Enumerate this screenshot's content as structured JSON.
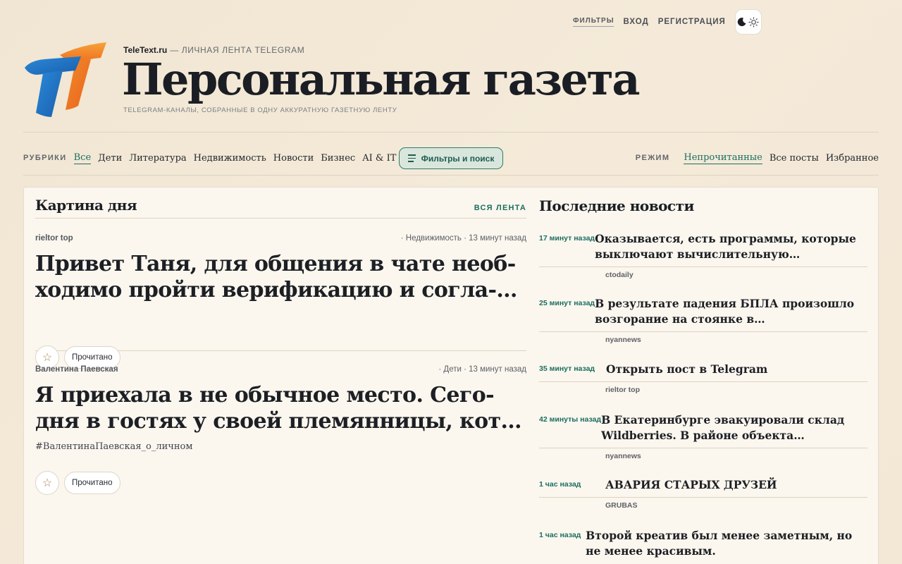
{
  "topnav": {
    "filters": "ФИЛЬТРЫ",
    "login": "ВХОД",
    "register": "РЕГИСТРАЦИЯ"
  },
  "masthead": {
    "site": "TeleText.ru",
    "tagline": "— ЛИЧНАЯ ЛЕНТА TELEGRAM",
    "title": "Персональная газета",
    "subtitle": "TELEGRAM-КАНАЛЫ, СОБРАННЫЕ В ОДНУ АККУРАТНУЮ ГАЗЕТНУЮ ЛЕНТУ"
  },
  "rubrics": {
    "label": "РУБРИКИ",
    "items": [
      "Все",
      "Дети",
      "Литература",
      "Недвижимость",
      "Новости",
      "Бизнес",
      "AI & IT"
    ],
    "active": "Все"
  },
  "filter_button": "Фильтры и поиск",
  "modes": {
    "label": "РЕЖИМ",
    "items": [
      "Непрочитанные",
      "Все посты",
      "Избранное"
    ],
    "active": "Непрочитанные"
  },
  "main": {
    "section_title": "Картина дня",
    "all_feed": "ВСЯ ЛЕНТА",
    "posts": [
      {
        "source": "rieltor top",
        "meta": "· Недвижимость · 13 минут назад",
        "title_line1": "Привет Таня, для общения в чате необ-",
        "title_line2": "ходимо пройти верификацию и согла-…",
        "tag": "",
        "read_label": "Прочитано",
        "star": "☆"
      },
      {
        "source": "Валентина Паевская",
        "meta": "· Дети · 13 минут назад",
        "title_line1": "Я приехала в не обычное место. Сего-",
        "title_line2": "дня в гостях у своей племянницы, кот…",
        "tag": "#ВалентинаПаевская_о_личном",
        "read_label": "Прочитано",
        "star": "☆"
      }
    ]
  },
  "latest": {
    "title": "Последние новости",
    "items": [
      {
        "time": "17 минут назад",
        "title": "Оказывается, есть программы, которые выключают вычислительную…",
        "source": "ctodaily"
      },
      {
        "time": "25 минут назад",
        "title": "В результате падения БПЛА произошло возгорание на стоянке в…",
        "source": "nyannews"
      },
      {
        "time": "35 минут назад",
        "title": "Открыть пост в Telegram",
        "source": "rieltor top"
      },
      {
        "time": "42 минуты назад",
        "title": "В Екатеринбурге эвакуировали склад Wildberries. В районе объекта…",
        "source": "nyannews"
      },
      {
        "time": "1 час назад",
        "title": "АВАРИЯ СТАРЫХ ДРУЗЕЙ",
        "source": "GRUBAS"
      },
      {
        "time": "1 час назад",
        "title": "Второй креатив был менее заметным, но не менее красивым.",
        "source": ""
      }
    ]
  },
  "colors": {
    "accent": "#1a6e60",
    "background": "#f3e8d6",
    "card": "#fbf6ee",
    "logo_blue": "#1f6fc0",
    "logo_orange": "#f07a22"
  },
  "icons": {
    "theme_dark": "moon-icon",
    "theme_light": "sun-icon",
    "filter": "menu-lines-icon",
    "favorite": "star-outline-icon"
  }
}
